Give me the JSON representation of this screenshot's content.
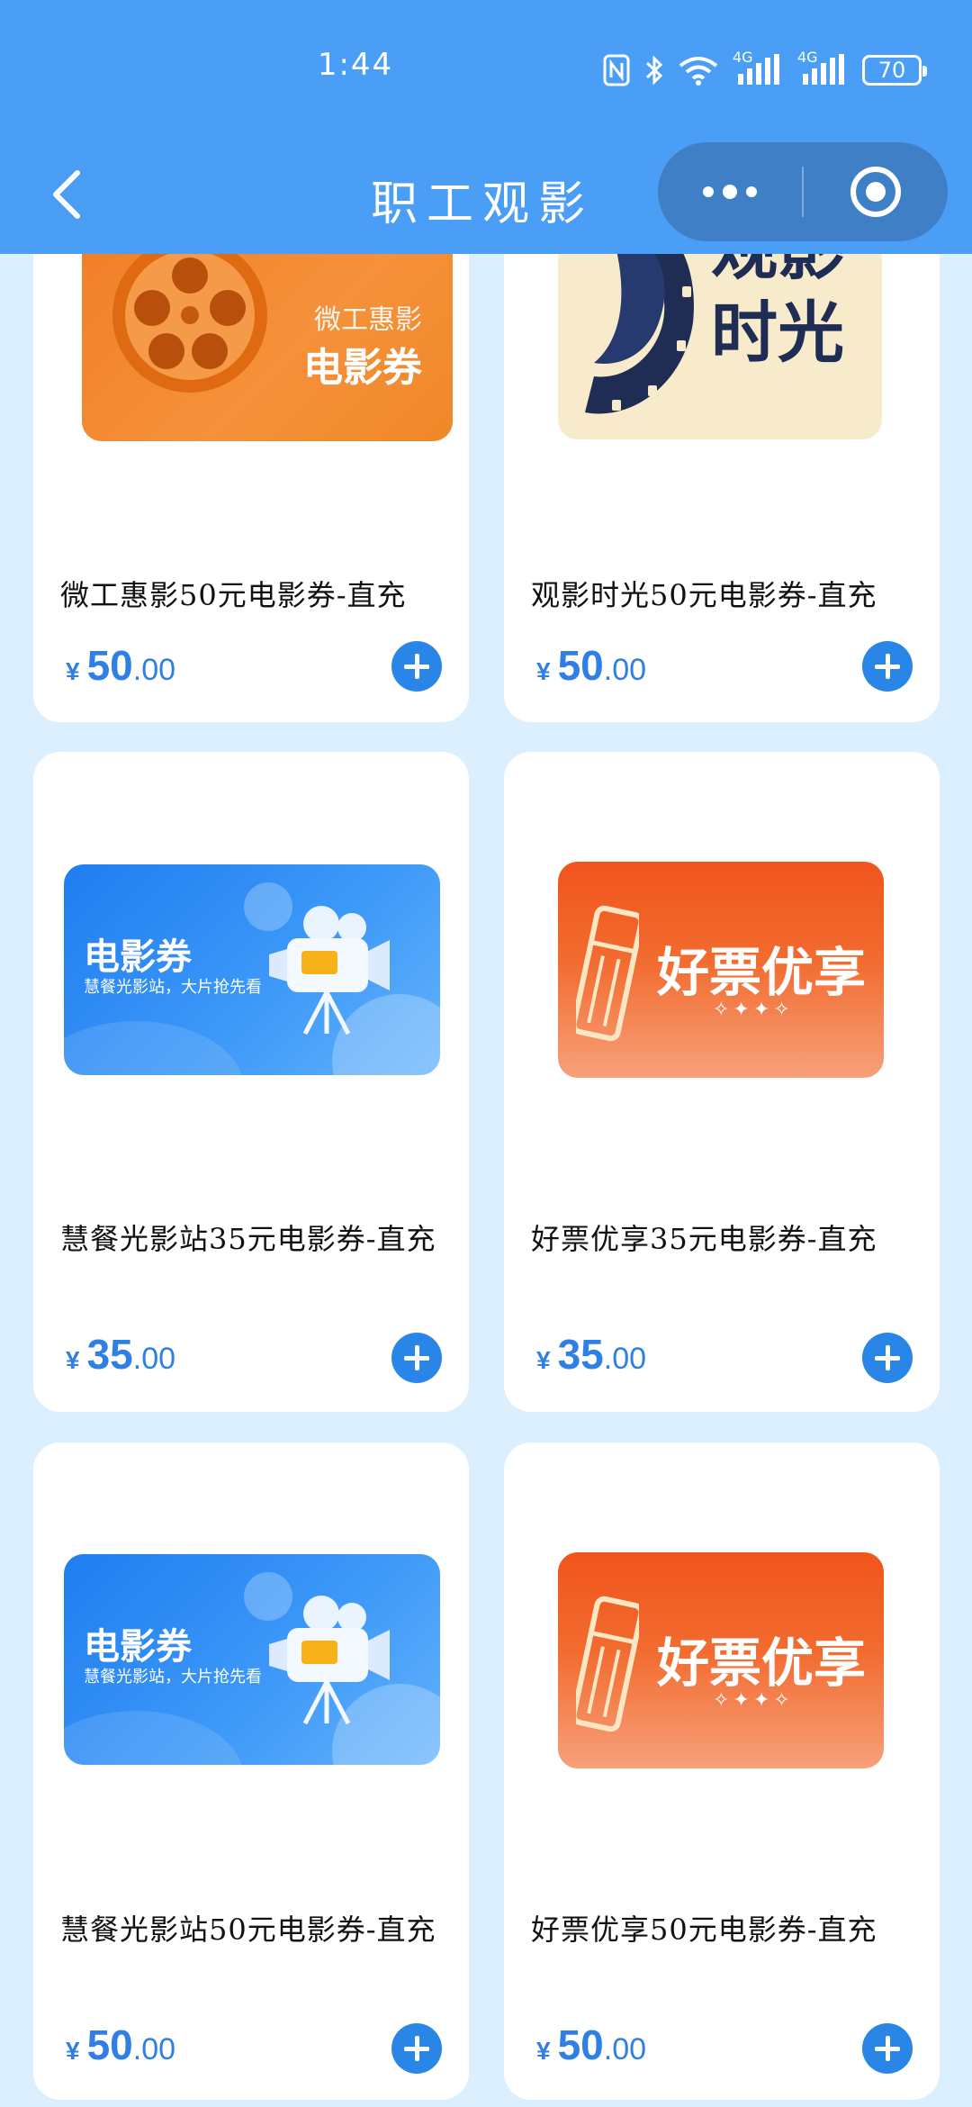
{
  "status_bar": {
    "time": "1:44",
    "battery": "70",
    "network_1": "4G",
    "network_2": "4G"
  },
  "header": {
    "title": "职工观影"
  },
  "colors": {
    "header_bg": "#4b9ef5",
    "page_bg": "#dcefff",
    "accent": "#2a86e6",
    "price": "#2f7fe4"
  },
  "products": [
    {
      "title": "微工惠影50元电影券-直充",
      "currency": "¥",
      "price_int": "50",
      "price_dec": ".00",
      "banner": {
        "line1": "微工惠影",
        "line2": "电影券"
      }
    },
    {
      "title": "观影时光50元电影券-直充",
      "currency": "¥",
      "price_int": "50",
      "price_dec": ".00",
      "banner": {
        "line1": "观影",
        "line2": "时光"
      }
    },
    {
      "title": "慧餐光影站35元电影券-直充",
      "currency": "¥",
      "price_int": "35",
      "price_dec": ".00",
      "banner": {
        "line1": "电影券",
        "line2": "慧餐光影站，大片抢先看"
      }
    },
    {
      "title": "好票优享35元电影券-直充",
      "currency": "¥",
      "price_int": "35",
      "price_dec": ".00",
      "banner": {
        "line1": "好票优享"
      }
    },
    {
      "title": "慧餐光影站50元电影券-直充",
      "currency": "¥",
      "price_int": "50",
      "price_dec": ".00",
      "banner": {
        "line1": "电影券",
        "line2": "慧餐光影站，大片抢先看"
      }
    },
    {
      "title": "好票优享50元电影券-直充",
      "currency": "¥",
      "price_int": "50",
      "price_dec": ".00",
      "banner": {
        "line1": "好票优享"
      }
    }
  ]
}
